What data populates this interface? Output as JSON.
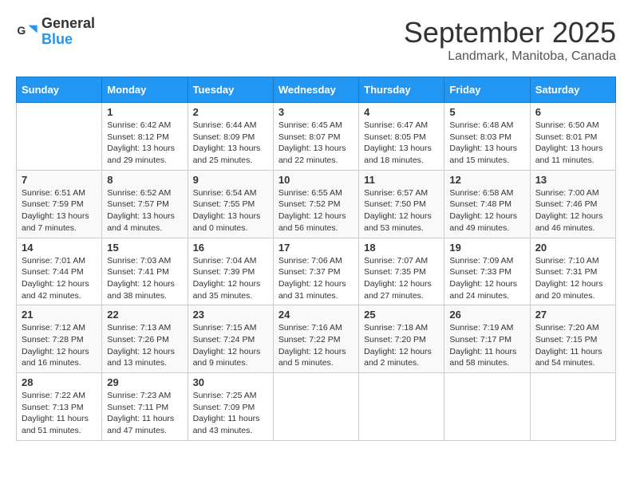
{
  "header": {
    "logo": {
      "general": "General",
      "blue": "Blue"
    },
    "title": "September 2025",
    "subtitle": "Landmark, Manitoba, Canada"
  },
  "calendar": {
    "days_of_week": [
      "Sunday",
      "Monday",
      "Tuesday",
      "Wednesday",
      "Thursday",
      "Friday",
      "Saturday"
    ],
    "weeks": [
      [
        {
          "day": "",
          "sunrise": "",
          "sunset": "",
          "daylight": ""
        },
        {
          "day": "1",
          "sunrise": "Sunrise: 6:42 AM",
          "sunset": "Sunset: 8:12 PM",
          "daylight": "Daylight: 13 hours and 29 minutes."
        },
        {
          "day": "2",
          "sunrise": "Sunrise: 6:44 AM",
          "sunset": "Sunset: 8:09 PM",
          "daylight": "Daylight: 13 hours and 25 minutes."
        },
        {
          "day": "3",
          "sunrise": "Sunrise: 6:45 AM",
          "sunset": "Sunset: 8:07 PM",
          "daylight": "Daylight: 13 hours and 22 minutes."
        },
        {
          "day": "4",
          "sunrise": "Sunrise: 6:47 AM",
          "sunset": "Sunset: 8:05 PM",
          "daylight": "Daylight: 13 hours and 18 minutes."
        },
        {
          "day": "5",
          "sunrise": "Sunrise: 6:48 AM",
          "sunset": "Sunset: 8:03 PM",
          "daylight": "Daylight: 13 hours and 15 minutes."
        },
        {
          "day": "6",
          "sunrise": "Sunrise: 6:50 AM",
          "sunset": "Sunset: 8:01 PM",
          "daylight": "Daylight: 13 hours and 11 minutes."
        }
      ],
      [
        {
          "day": "7",
          "sunrise": "Sunrise: 6:51 AM",
          "sunset": "Sunset: 7:59 PM",
          "daylight": "Daylight: 13 hours and 7 minutes."
        },
        {
          "day": "8",
          "sunrise": "Sunrise: 6:52 AM",
          "sunset": "Sunset: 7:57 PM",
          "daylight": "Daylight: 13 hours and 4 minutes."
        },
        {
          "day": "9",
          "sunrise": "Sunrise: 6:54 AM",
          "sunset": "Sunset: 7:55 PM",
          "daylight": "Daylight: 13 hours and 0 minutes."
        },
        {
          "day": "10",
          "sunrise": "Sunrise: 6:55 AM",
          "sunset": "Sunset: 7:52 PM",
          "daylight": "Daylight: 12 hours and 56 minutes."
        },
        {
          "day": "11",
          "sunrise": "Sunrise: 6:57 AM",
          "sunset": "Sunset: 7:50 PM",
          "daylight": "Daylight: 12 hours and 53 minutes."
        },
        {
          "day": "12",
          "sunrise": "Sunrise: 6:58 AM",
          "sunset": "Sunset: 7:48 PM",
          "daylight": "Daylight: 12 hours and 49 minutes."
        },
        {
          "day": "13",
          "sunrise": "Sunrise: 7:00 AM",
          "sunset": "Sunset: 7:46 PM",
          "daylight": "Daylight: 12 hours and 46 minutes."
        }
      ],
      [
        {
          "day": "14",
          "sunrise": "Sunrise: 7:01 AM",
          "sunset": "Sunset: 7:44 PM",
          "daylight": "Daylight: 12 hours and 42 minutes."
        },
        {
          "day": "15",
          "sunrise": "Sunrise: 7:03 AM",
          "sunset": "Sunset: 7:41 PM",
          "daylight": "Daylight: 12 hours and 38 minutes."
        },
        {
          "day": "16",
          "sunrise": "Sunrise: 7:04 AM",
          "sunset": "Sunset: 7:39 PM",
          "daylight": "Daylight: 12 hours and 35 minutes."
        },
        {
          "day": "17",
          "sunrise": "Sunrise: 7:06 AM",
          "sunset": "Sunset: 7:37 PM",
          "daylight": "Daylight: 12 hours and 31 minutes."
        },
        {
          "day": "18",
          "sunrise": "Sunrise: 7:07 AM",
          "sunset": "Sunset: 7:35 PM",
          "daylight": "Daylight: 12 hours and 27 minutes."
        },
        {
          "day": "19",
          "sunrise": "Sunrise: 7:09 AM",
          "sunset": "Sunset: 7:33 PM",
          "daylight": "Daylight: 12 hours and 24 minutes."
        },
        {
          "day": "20",
          "sunrise": "Sunrise: 7:10 AM",
          "sunset": "Sunset: 7:31 PM",
          "daylight": "Daylight: 12 hours and 20 minutes."
        }
      ],
      [
        {
          "day": "21",
          "sunrise": "Sunrise: 7:12 AM",
          "sunset": "Sunset: 7:28 PM",
          "daylight": "Daylight: 12 hours and 16 minutes."
        },
        {
          "day": "22",
          "sunrise": "Sunrise: 7:13 AM",
          "sunset": "Sunset: 7:26 PM",
          "daylight": "Daylight: 12 hours and 13 minutes."
        },
        {
          "day": "23",
          "sunrise": "Sunrise: 7:15 AM",
          "sunset": "Sunset: 7:24 PM",
          "daylight": "Daylight: 12 hours and 9 minutes."
        },
        {
          "day": "24",
          "sunrise": "Sunrise: 7:16 AM",
          "sunset": "Sunset: 7:22 PM",
          "daylight": "Daylight: 12 hours and 5 minutes."
        },
        {
          "day": "25",
          "sunrise": "Sunrise: 7:18 AM",
          "sunset": "Sunset: 7:20 PM",
          "daylight": "Daylight: 12 hours and 2 minutes."
        },
        {
          "day": "26",
          "sunrise": "Sunrise: 7:19 AM",
          "sunset": "Sunset: 7:17 PM",
          "daylight": "Daylight: 11 hours and 58 minutes."
        },
        {
          "day": "27",
          "sunrise": "Sunrise: 7:20 AM",
          "sunset": "Sunset: 7:15 PM",
          "daylight": "Daylight: 11 hours and 54 minutes."
        }
      ],
      [
        {
          "day": "28",
          "sunrise": "Sunrise: 7:22 AM",
          "sunset": "Sunset: 7:13 PM",
          "daylight": "Daylight: 11 hours and 51 minutes."
        },
        {
          "day": "29",
          "sunrise": "Sunrise: 7:23 AM",
          "sunset": "Sunset: 7:11 PM",
          "daylight": "Daylight: 11 hours and 47 minutes."
        },
        {
          "day": "30",
          "sunrise": "Sunrise: 7:25 AM",
          "sunset": "Sunset: 7:09 PM",
          "daylight": "Daylight: 11 hours and 43 minutes."
        },
        {
          "day": "",
          "sunrise": "",
          "sunset": "",
          "daylight": ""
        },
        {
          "day": "",
          "sunrise": "",
          "sunset": "",
          "daylight": ""
        },
        {
          "day": "",
          "sunrise": "",
          "sunset": "",
          "daylight": ""
        },
        {
          "day": "",
          "sunrise": "",
          "sunset": "",
          "daylight": ""
        }
      ]
    ]
  }
}
